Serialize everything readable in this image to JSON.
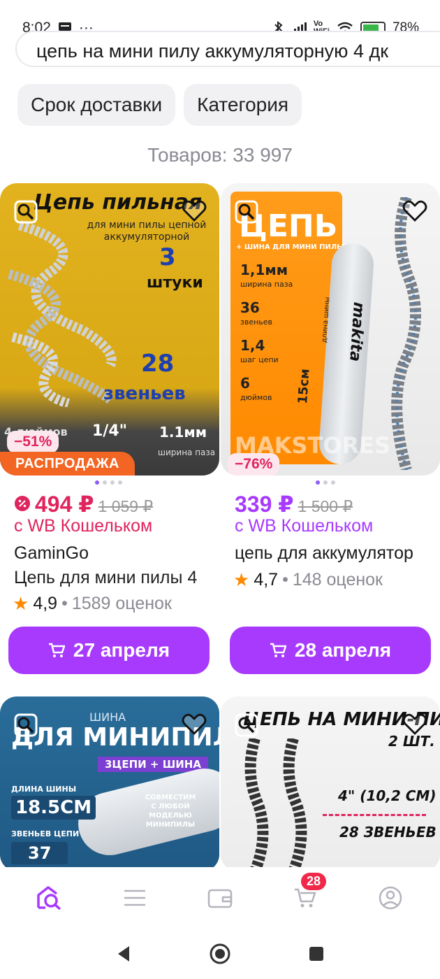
{
  "status_bar": {
    "time": "8:02",
    "left_icons": [
      "message-icon",
      "more-dots-icon"
    ],
    "right_icons": [
      "bluetooth-icon",
      "signal-icon",
      "vowifi-icon",
      "wifi-icon",
      "battery-icon"
    ],
    "vowifi_label": "Vo\nWiFi",
    "battery": "78%"
  },
  "search": {
    "query": "цепь на мини пилу аккумуляторную 4 дк"
  },
  "filters": {
    "delivery_label": "Срок доставки",
    "category_label": "Категория"
  },
  "results_count": "Товаров: 33 997",
  "products": [
    {
      "image_text": {
        "title": "Цепь пильная",
        "subtitle": "для мини пилы цепной аккумуляторной",
        "qty_num": "3",
        "qty_word": "штуки",
        "links_num": "28",
        "links_word": "звеньев",
        "spec1": "4 дюймов",
        "spec2": "1/4\"",
        "spec3": "1.1мм",
        "spec3_sub": "ширина паза"
      },
      "discount": "−51%",
      "sale_label": "РАСПРОДАЖА",
      "price_now": "494 ₽",
      "price_old": "1 059 ₽",
      "wallet": "с WB Кошельком",
      "brand": "GaminGo",
      "name": "Цепь для мини пилы 4",
      "score": "4,9",
      "reviews": "1589 оценок",
      "delivery": "27 апреля",
      "price_color": "#e0245e"
    },
    {
      "image_text": {
        "title": "ЦЕПЬ",
        "subtitle": "+ ШИНА ДЛЯ МИНИ ПИЛЫ",
        "spec1": "1,1мм",
        "spec1_sub": "ширина паза",
        "spec2": "36",
        "spec2_sub": "звеньев",
        "spec3": "1,4",
        "spec3_sub": "шаг цепи",
        "spec4": "6",
        "spec4_sub": "дюймов",
        "bar_brand": "makita",
        "bar_len": "15см",
        "bar_len_sub": "длина шины",
        "watermark": "MAKSTORES"
      },
      "discount": "−76%",
      "price_now": "339 ₽",
      "price_old": "1 500 ₽",
      "wallet": "с WB Кошельком",
      "name": "цепь для аккумулятор",
      "score": "4,7",
      "reviews": "148 оценок",
      "delivery": "28 апреля",
      "price_color": "#a73afd"
    },
    {
      "image_text": {
        "top": "ШИНА",
        "title": "ДЛЯ МИНИПИЛЫ",
        "ribbon": "3ЦЕПИ + ШИНА",
        "len_label": "ДЛИНА ШИНЫ",
        "len_value": "18.5CM",
        "links_label": "ЗВЕНЬЕВ ЦЕПИ",
        "links_value": "37",
        "compat": "СОВМЕСТИМ С ЛЮБОЙ МОДЕЛЬЮ МИНИПИЛЫ"
      }
    },
    {
      "image_text": {
        "title": "ЦЕПЬ НА МИНИ-ПИЛУ",
        "qty": "2 ШТ.",
        "size": "4\" (10,2 СМ)",
        "links": "28 ЗВЕНЬЕВ"
      }
    }
  ],
  "bottom_nav": {
    "cart_count": "28"
  },
  "colors": {
    "accent": "#a73afd",
    "sale_price": "#e0245e",
    "orange_badge": "#f26522"
  }
}
